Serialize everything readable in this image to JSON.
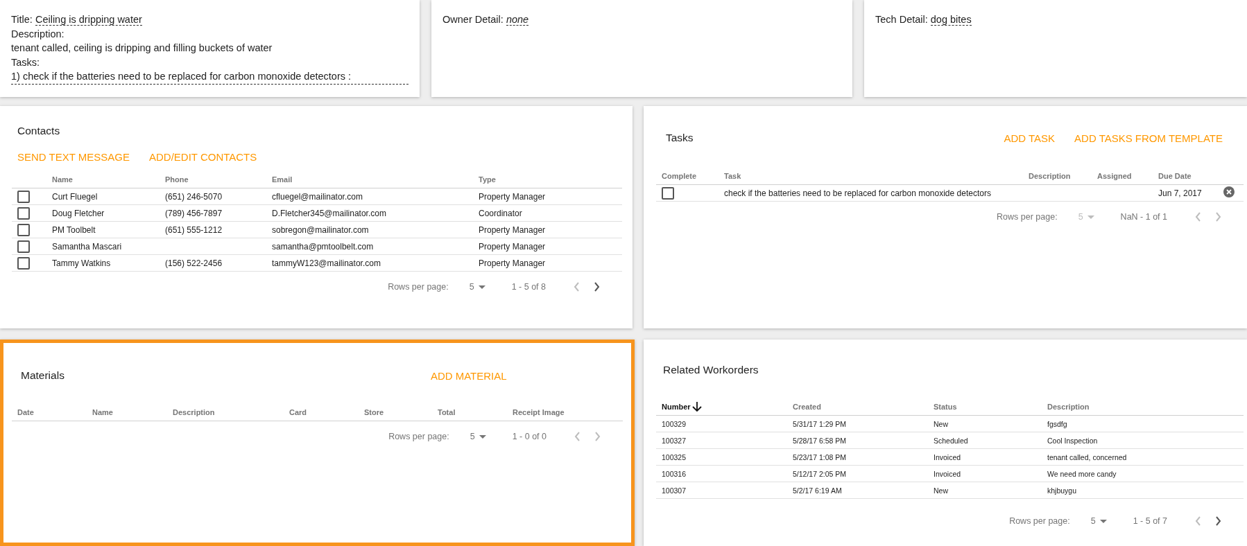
{
  "summary": {
    "title_label": "Title:",
    "title": "Ceiling is dripping water",
    "description_label": "Description:",
    "description": "tenant called, ceiling is dripping and filling buckets of water",
    "tasks_label": "Tasks:",
    "tasks": "1) check if the batteries need to be replaced for carbon monoxide detectors :"
  },
  "owner_detail": {
    "label": "Owner Detail:",
    "value": "none"
  },
  "tech_detail": {
    "label": "Tech Detail:",
    "value": "dog bites"
  },
  "contacts": {
    "title": "Contacts",
    "actions": [
      "SEND TEXT MESSAGE",
      "ADD/EDIT CONTACTS"
    ],
    "columns": [
      {
        "label": "Name",
        "sorted": false
      },
      {
        "label": "Phone",
        "sorted": false
      },
      {
        "label": "Email",
        "sorted": false
      },
      {
        "label": "Type",
        "sorted": false
      }
    ],
    "rows": [
      {
        "checked": false,
        "cells": [
          "Curt Fluegel",
          "(651) 246-5070",
          "cfluegel@mailinator.com",
          "Property Manager"
        ]
      },
      {
        "checked": false,
        "cells": [
          "Doug Fletcher",
          "(789) 456-7897",
          "D.Fletcher345@mailinator.com",
          "Coordinator"
        ]
      },
      {
        "checked": false,
        "cells": [
          "PM Toolbelt",
          "(651) 555-1212",
          "sobregon@mailinator.com",
          "Property Manager"
        ]
      },
      {
        "checked": false,
        "cells": [
          "Samantha Mascari",
          null,
          "samantha@pmtoolbelt.com",
          "Property Manager"
        ]
      },
      {
        "checked": false,
        "cells": [
          "Tammy Watkins",
          "(156) 522-2456",
          "tammyW123@mailinator.com",
          "Property Manager"
        ]
      }
    ],
    "pagination": {
      "rows_label": "Rows per page:",
      "page_size": "5",
      "page_size_disabled": false,
      "range": "1 - 5 of 8",
      "prev_disabled": true,
      "next_disabled": false
    }
  },
  "tasks": {
    "title": "Tasks",
    "actions": [
      "ADD TASK",
      "ADD TASKS FROM TEMPLATE"
    ],
    "columns": [
      {
        "label": "Task",
        "sorted": false
      },
      {
        "label": "Description",
        "sorted": false
      },
      {
        "label": "Assigned",
        "sorted": false
      },
      {
        "label": "Due Date",
        "sorted": false
      }
    ],
    "check_column": "Complete",
    "rows": [
      {
        "checked": false,
        "cells": [
          "check if the batteries need to be replaced for carbon monoxide detectors",
          null,
          null,
          "Jun 7, 2017"
        ]
      }
    ],
    "pagination": {
      "rows_label": "Rows per page:",
      "page_size": "5",
      "page_size_disabled": true,
      "range": "NaN - 1 of 1",
      "prev_disabled": true,
      "next_disabled": true
    }
  },
  "materials": {
    "title": "Materials",
    "focused": true,
    "actions": [
      "ADD MATERIAL"
    ],
    "columns": [
      {
        "label": "Date",
        "sorted": false
      },
      {
        "label": "Name",
        "sorted": false
      },
      {
        "label": "Description",
        "sorted": false
      },
      {
        "label": "Card",
        "sorted": false
      },
      {
        "label": "Store",
        "sorted": false
      },
      {
        "label": "Total",
        "sorted": false
      },
      {
        "label": "Receipt Image",
        "sorted": false
      }
    ],
    "pagination": {
      "rows_label": "Rows per page:",
      "page_size": "5",
      "page_size_disabled": false,
      "range": "1 - 0 of 0",
      "prev_disabled": true,
      "next_disabled": true
    }
  },
  "related_workorders": {
    "title": "Related Workorders",
    "columns": [
      {
        "label": "Number",
        "sorted": true
      },
      {
        "label": "Created",
        "sorted": false
      },
      {
        "label": "Status",
        "sorted": false
      },
      {
        "label": "Description",
        "sorted": false
      }
    ],
    "rows": [
      {
        "cells": [
          "100329",
          "5/31/17 1:29 PM",
          "New",
          "fgsdfg"
        ]
      },
      {
        "cells": [
          "100327",
          "5/28/17 6:58 PM",
          "Scheduled",
          "Cool Inspection"
        ]
      },
      {
        "cells": [
          "100325",
          "5/23/17 1:08 PM",
          "Invoiced",
          "tenant called, concerned"
        ]
      },
      {
        "cells": [
          "100316",
          "5/12/17 2:05 PM",
          "Invoiced",
          "We need more candy"
        ]
      },
      {
        "cells": [
          "100307",
          "5/2/17 6:19 AM",
          "New",
          "khjbuygu"
        ]
      }
    ],
    "pagination": {
      "rows_label": "Rows per page:",
      "page_size": "5",
      "page_size_disabled": false,
      "range": "1 - 5 of 7",
      "prev_disabled": true,
      "next_disabled": false
    }
  }
}
